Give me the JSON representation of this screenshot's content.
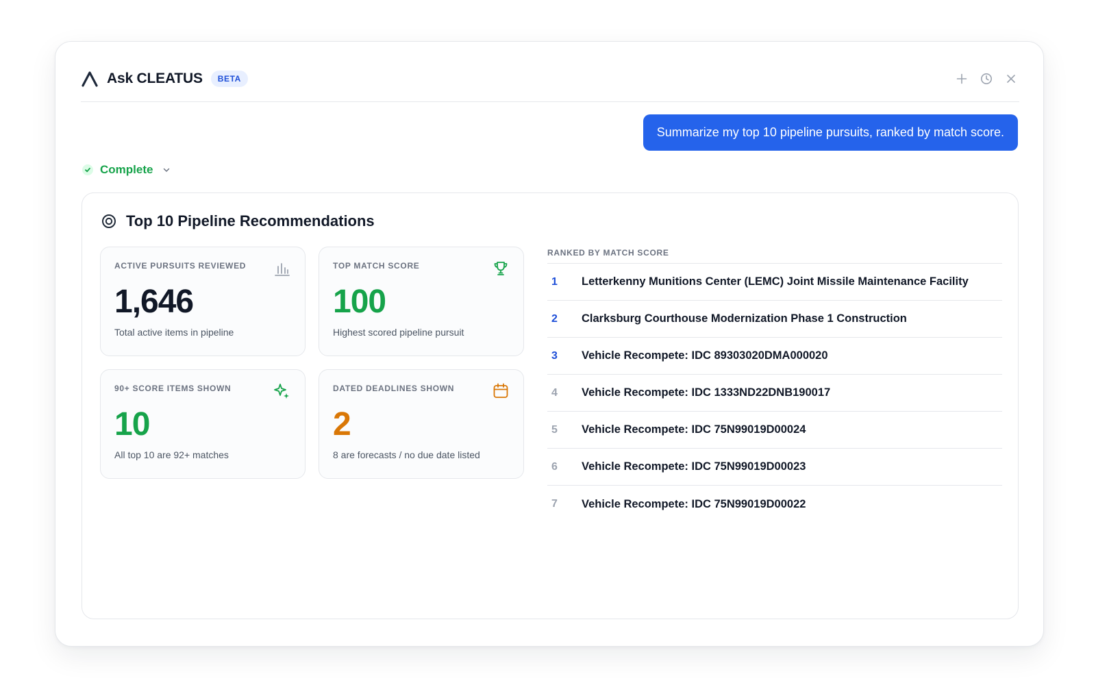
{
  "header": {
    "title": "Ask CLEATUS",
    "badge": "BETA",
    "actions": [
      "plus-icon",
      "history-icon",
      "close-icon"
    ]
  },
  "conversation": {
    "user_message": "Summarize my top 10 pipeline pursuits, ranked by match score.",
    "status": "Complete"
  },
  "result": {
    "title": "Top 10 Pipeline Recommendations",
    "stats": [
      {
        "label": "ACTIVE PURSUITS REVIEWED",
        "value": "1,646",
        "caption": "Total active items in pipeline",
        "icon": "bar-chart-icon",
        "color": "#111827"
      },
      {
        "label": "TOP MATCH SCORE",
        "value": "100",
        "caption": "Highest scored pipeline pursuit",
        "icon": "trophy-icon",
        "color": "#16a34a"
      },
      {
        "label": "90+ SCORE ITEMS SHOWN",
        "value": "10",
        "caption": "All top 10 are 92+ matches",
        "icon": "sparkles-icon",
        "color": "#16a34a"
      },
      {
        "label": "DATED DEADLINES SHOWN",
        "value": "2",
        "caption": "8 are forecasts / no due date listed",
        "icon": "calendar-icon",
        "color": "#d97706"
      }
    ],
    "ranked_label": "RANKED BY MATCH SCORE",
    "ranked": [
      {
        "rank": "1",
        "title": "Letterkenny Munitions Center (LEMC) Joint Missile Maintenance Facility"
      },
      {
        "rank": "2",
        "title": "Clarksburg Courthouse Modernization Phase 1 Construction"
      },
      {
        "rank": "3",
        "title": "Vehicle Recompete: IDC 89303020DMA000020"
      },
      {
        "rank": "4",
        "title": "Vehicle Recompete: IDC 1333ND22DNB190017"
      },
      {
        "rank": "5",
        "title": "Vehicle Recompete: IDC 75N99019D00024"
      },
      {
        "rank": "6",
        "title": "Vehicle Recompete: IDC 75N99019D00023"
      },
      {
        "rank": "7",
        "title": "Vehicle Recompete: IDC 75N99019D00022"
      }
    ]
  },
  "colors": {
    "accent": "#2563eb",
    "success": "#16a34a",
    "warning": "#d97706",
    "rank_top": "#1d4ed8",
    "rank_rest": "#9ca3af"
  }
}
